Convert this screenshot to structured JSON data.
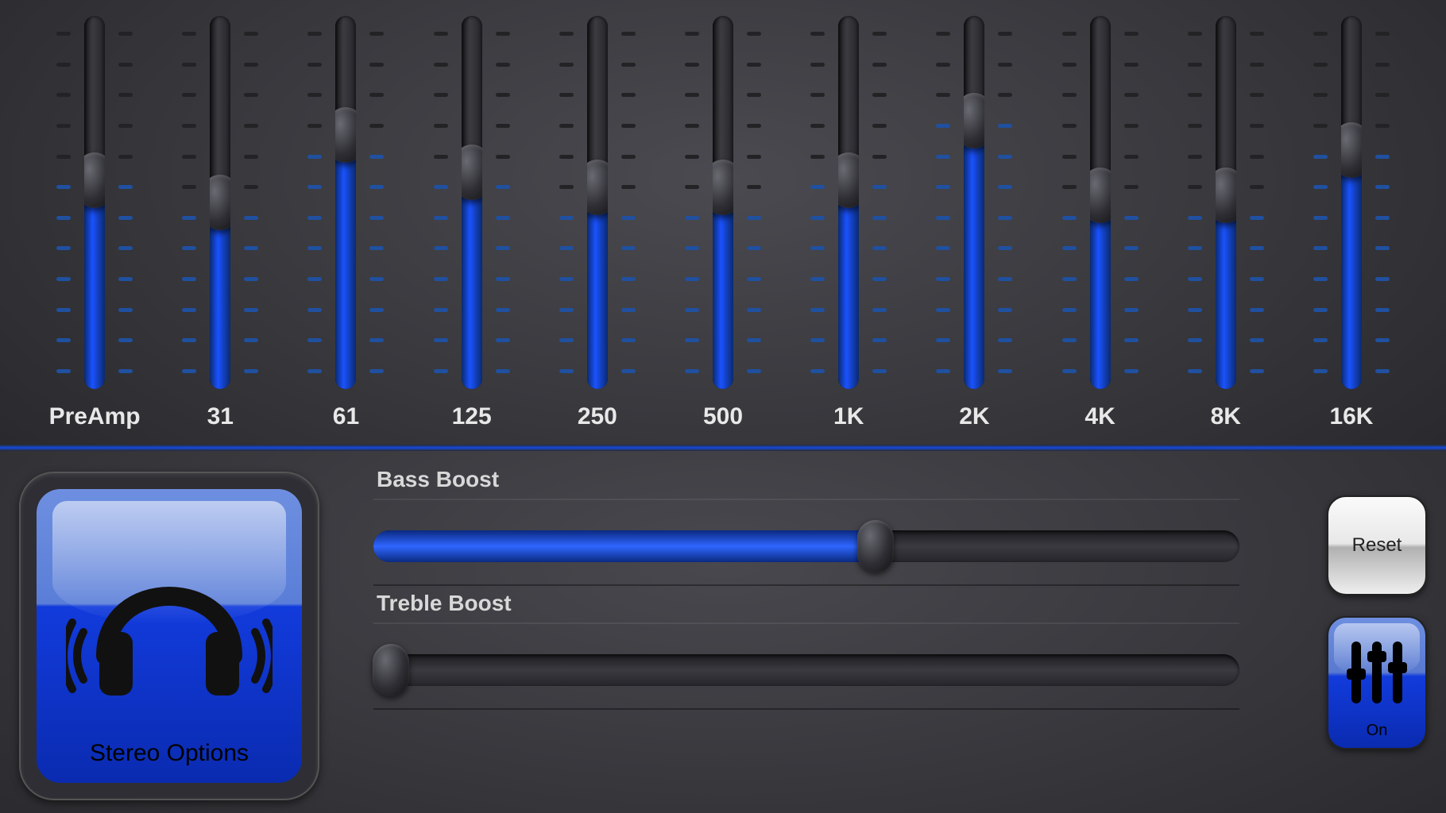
{
  "equalizer": {
    "tick_count": 12,
    "bands": [
      {
        "label": "PreAmp",
        "value": 56
      },
      {
        "label": "31",
        "value": 50
      },
      {
        "label": "61",
        "value": 68
      },
      {
        "label": "125",
        "value": 58
      },
      {
        "label": "250",
        "value": 54
      },
      {
        "label": "500",
        "value": 54
      },
      {
        "label": "1K",
        "value": 56
      },
      {
        "label": "2K",
        "value": 72
      },
      {
        "label": "4K",
        "value": 52
      },
      {
        "label": "8K",
        "value": 52
      },
      {
        "label": "16K",
        "value": 64
      }
    ]
  },
  "boosts": {
    "bass": {
      "label": "Bass Boost",
      "value": 58
    },
    "treble": {
      "label": "Treble Boost",
      "value": 2
    }
  },
  "stereo_button": {
    "label": "Stereo Options"
  },
  "side": {
    "reset_label": "Reset",
    "on_label": "On"
  },
  "colors": {
    "accent": "#1a52ff",
    "accent_dark": "#0a2bb0"
  }
}
